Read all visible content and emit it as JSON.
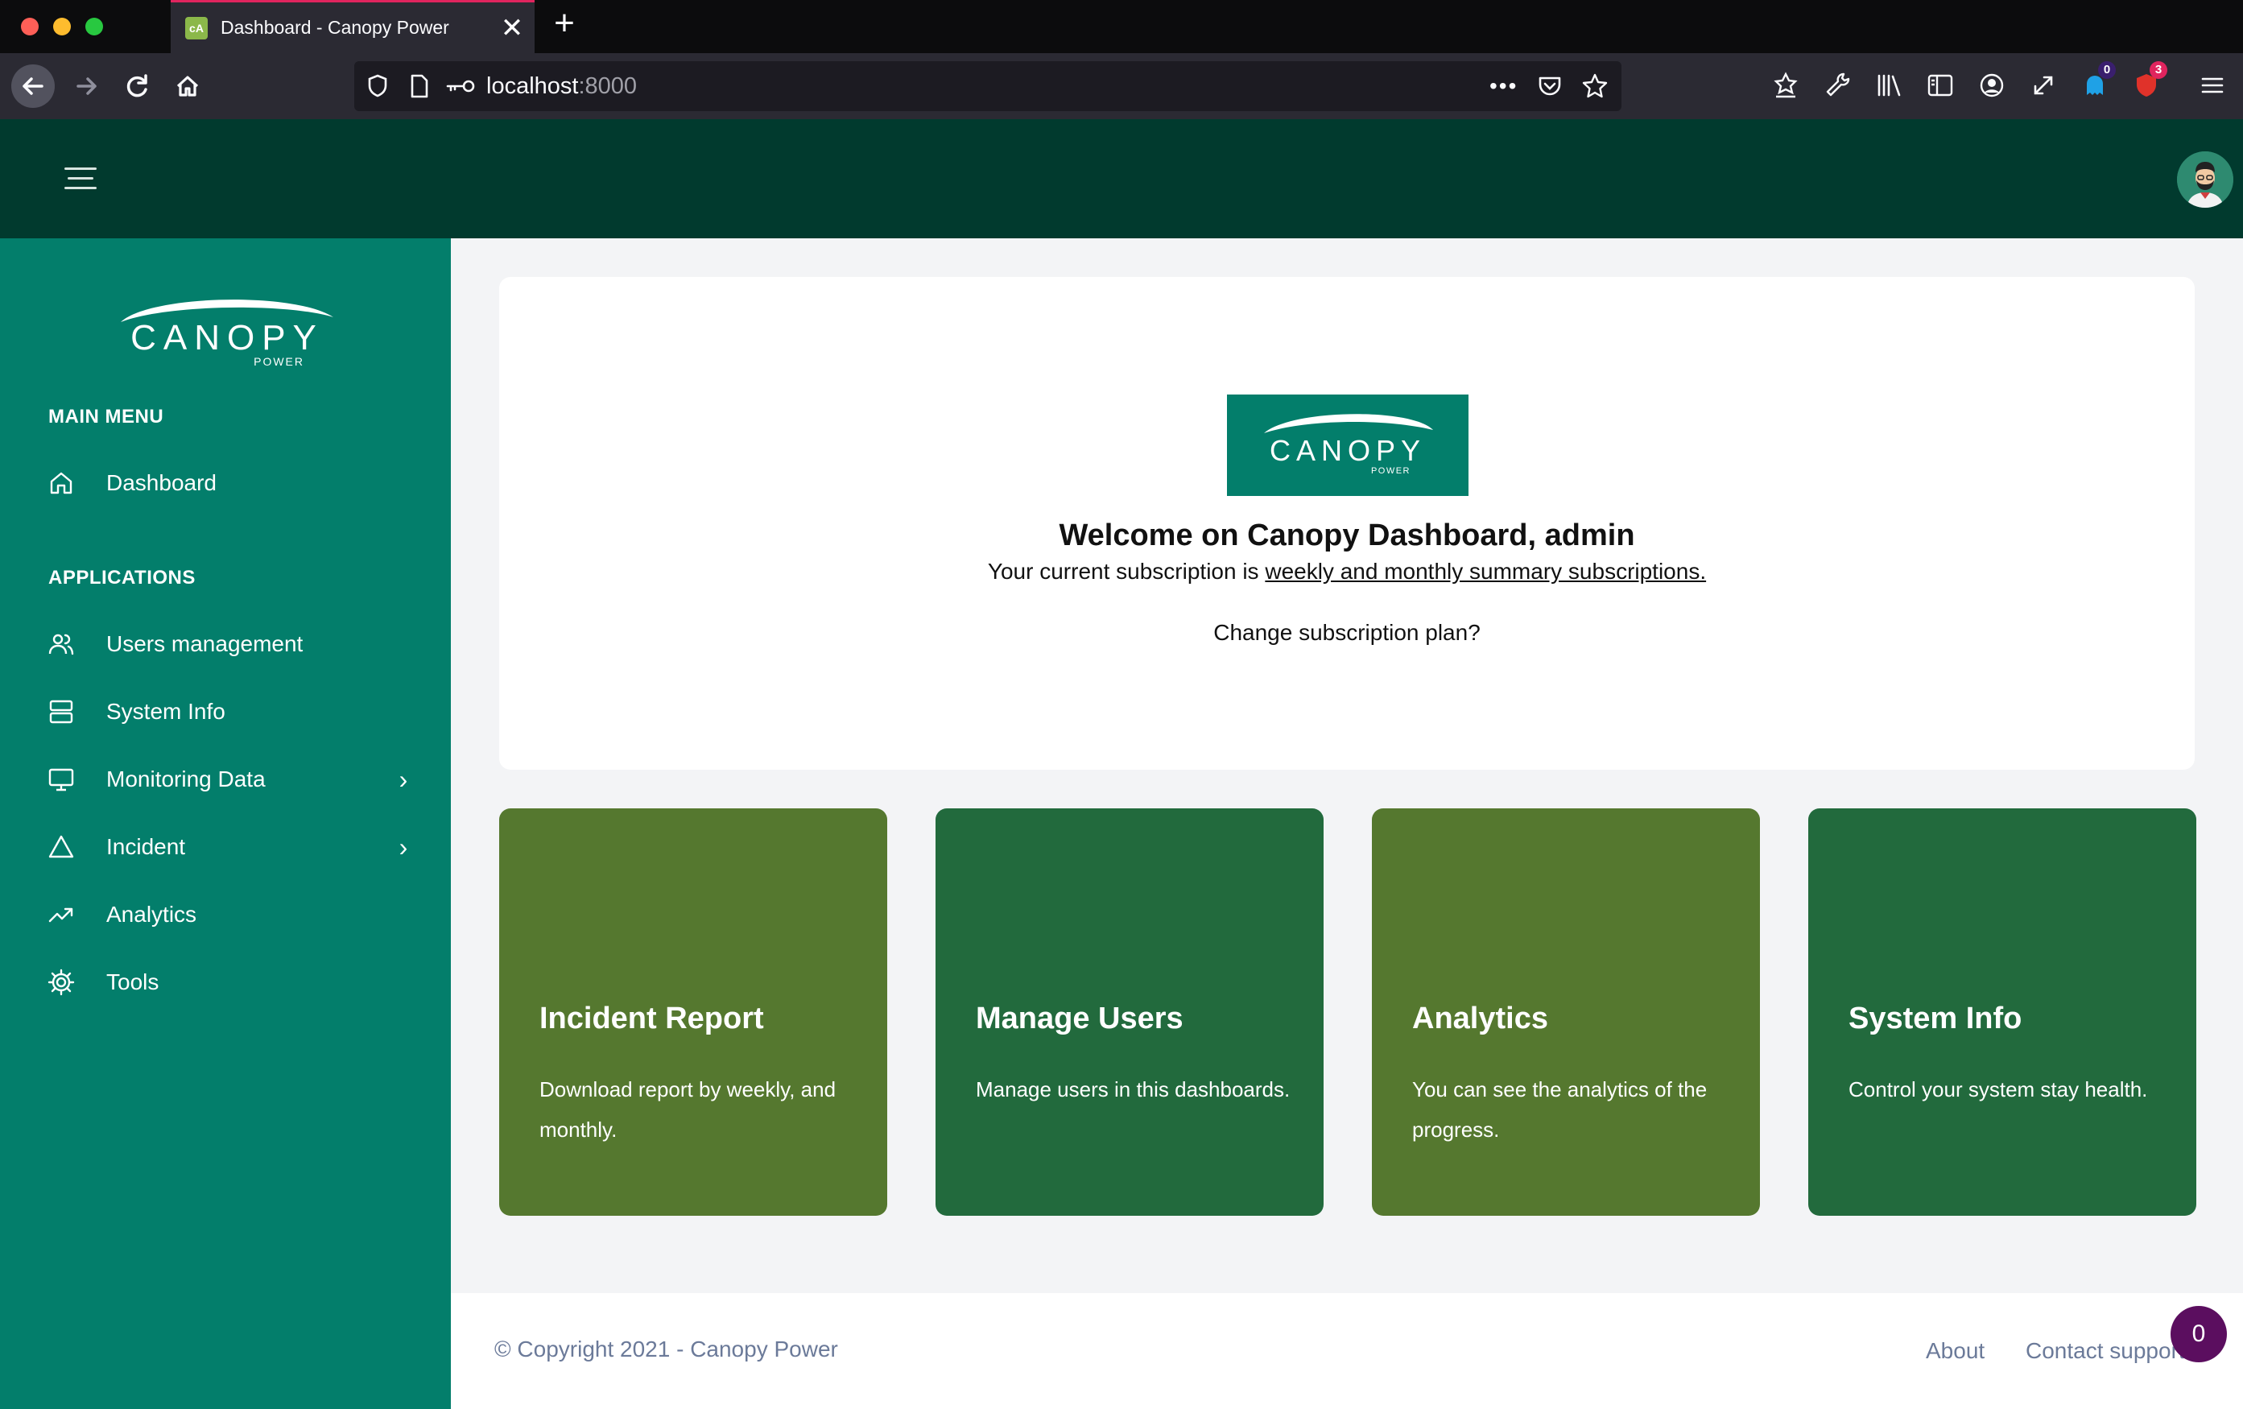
{
  "browser": {
    "tab_title": "Dashboard - Canopy Power",
    "url_host": "localhost",
    "url_port": ":8000",
    "badges": {
      "extension_a": "0",
      "extension_b": "3"
    }
  },
  "sidebar": {
    "logo_text": "CANOPY",
    "logo_sub": "POWER",
    "main_menu_heading": "MAIN MENU",
    "applications_heading": "APPLICATIONS",
    "items": [
      {
        "label": "Dashboard",
        "icon": "home-icon"
      },
      {
        "label": "Users management",
        "icon": "users-icon"
      },
      {
        "label": "System Info",
        "icon": "server-icon"
      },
      {
        "label": "Monitoring Data",
        "icon": "monitor-icon",
        "has_submenu": true
      },
      {
        "label": "Incident",
        "icon": "warning-icon",
        "has_submenu": true
      },
      {
        "label": "Analytics",
        "icon": "trending-icon"
      },
      {
        "label": "Tools",
        "icon": "gear-icon"
      }
    ]
  },
  "welcome": {
    "logo_text": "CANOPY",
    "logo_sub": "POWER",
    "title": "Welcome on Canopy Dashboard, admin",
    "subscription_prefix": "Your current subscription is",
    "subscription_link": "weekly and monthly summary subscriptions.",
    "change_plan": "Change subscription plan?"
  },
  "cards": [
    {
      "title": "Incident Report",
      "desc": "Download report by weekly, and monthly.",
      "color": "#55782f"
    },
    {
      "title": "Manage Users",
      "desc": "Manage users in this dashboards.",
      "color": "#226a3d"
    },
    {
      "title": "Analytics",
      "desc": "You can see the analytics of the progress.",
      "color": "#55782f"
    },
    {
      "title": "System Info",
      "desc": "Control your system stay health.",
      "color": "#226a3d"
    }
  ],
  "footer": {
    "copyright": "© Copyright 2021 - Canopy Power",
    "about": "About",
    "contact": "Contact support",
    "chat_count": "0"
  },
  "colors": {
    "topbar": "#013a2e",
    "sidebar": "#037e6b",
    "card_green": "#55782f",
    "card_dark": "#226a3d"
  }
}
